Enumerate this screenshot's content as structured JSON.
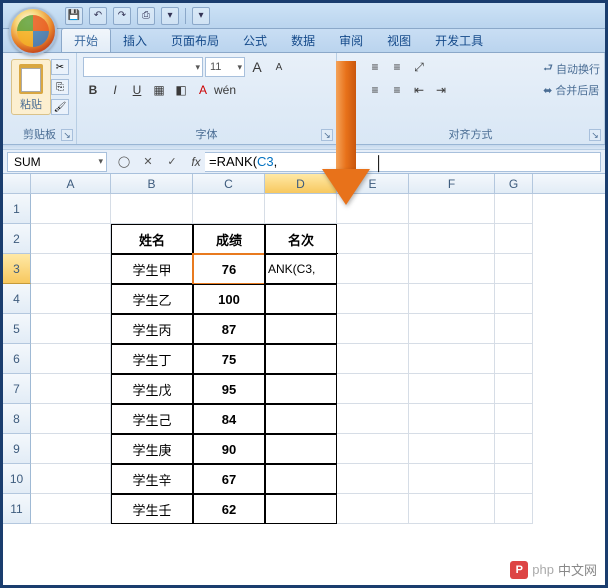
{
  "qat": {
    "save": "💾",
    "undo": "↶",
    "redo": "↷",
    "print": "⎙",
    "dd1": "▾",
    "dd2": "▾"
  },
  "tabs": [
    "开始",
    "插入",
    "页面布局",
    "公式",
    "数据",
    "审阅",
    "视图",
    "开发工具"
  ],
  "ribbon": {
    "clipboard": {
      "paste": "粘贴",
      "label": "剪贴板"
    },
    "font": {
      "size": "11",
      "growA": "A",
      "shrinkA": "A",
      "label": "字体"
    },
    "align": {
      "wrap": "自动换行",
      "merge": "合并后居",
      "label": "对齐方式"
    }
  },
  "namebox": "SUM",
  "fx": {
    "cancel": "✕",
    "enter": "✓",
    "fx": "fx"
  },
  "formula_prefix": "=RANK(",
  "formula_ref": "C3",
  "formula_suffix": ",",
  "columns": [
    "A",
    "B",
    "C",
    "D",
    "E",
    "F",
    "G"
  ],
  "rows": [
    "1",
    "2",
    "3",
    "4",
    "5",
    "6",
    "7",
    "8",
    "9",
    "10",
    "11"
  ],
  "table": {
    "headers": [
      "姓名",
      "成绩",
      "名次"
    ],
    "data": [
      [
        "学生甲",
        "76",
        "ANK(C3,"
      ],
      [
        "学生乙",
        "100",
        ""
      ],
      [
        "学生丙",
        "87",
        ""
      ],
      [
        "学生丁",
        "75",
        ""
      ],
      [
        "学生戊",
        "95",
        ""
      ],
      [
        "学生己",
        "84",
        ""
      ],
      [
        "学生庚",
        "90",
        ""
      ],
      [
        "学生辛",
        "67",
        ""
      ],
      [
        "学生壬",
        "62",
        ""
      ]
    ]
  },
  "watermark": "中文网",
  "watermark_prefix": "php"
}
